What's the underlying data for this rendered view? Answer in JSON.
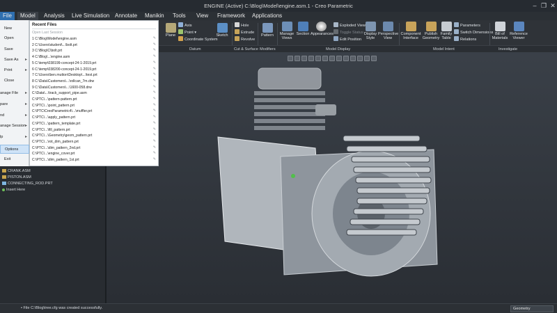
{
  "window": {
    "title": "ENGINE (Active) C:\\Blog\\Model\\engine.asm.1 - Creo Parametric"
  },
  "menu_tabs": [
    "File",
    "Model",
    "Analysis",
    "Live Simulation",
    "Annotate",
    "Manikin",
    "Tools",
    "View",
    "Framework",
    "Applications"
  ],
  "ribbon": {
    "datum": {
      "plane": "Plane",
      "axis": "Axis",
      "point": "Point",
      "csys": "Coordinate System",
      "sketch": "Sketch"
    },
    "cut_surface": {
      "hole": "Hole",
      "extrude": "Extrude",
      "revolve": "Revolve"
    },
    "pattern": "Pattern",
    "model_display": {
      "manage_views": "Manage Views",
      "section": "Section",
      "appearances": "Appearances",
      "exploded": "Exploded View",
      "toggle": "Toggle Status",
      "edit_pos": "Edit Position",
      "display_style": "Display Style",
      "perspective": "Perspective View"
    },
    "model_intent": {
      "component_interface": "Component Interface",
      "publish_geometry": "Publish Geometry",
      "family_table": "Family Table",
      "parameters": "Parameters",
      "switch_dim": "Switch Dimensions",
      "relations": "Relations"
    },
    "investigate": {
      "bom": "Bill of Materials",
      "ref_viewer": "Reference Viewer"
    }
  },
  "groups": [
    "Datum",
    "Cut & Surface",
    "Modifiers",
    "Model Display",
    "Model Intent",
    "Investigate"
  ],
  "file_menu": [
    {
      "label": "New",
      "arrow": false
    },
    {
      "label": "Open",
      "arrow": false
    },
    {
      "label": "Save",
      "arrow": false
    },
    {
      "label": "Save As",
      "arrow": true
    },
    {
      "label": "Print",
      "arrow": true
    },
    {
      "label": "Close",
      "arrow": false
    },
    {
      "label": "anage File",
      "arrow": true
    },
    {
      "label": "pare",
      "arrow": true
    },
    {
      "label": "nd",
      "arrow": true
    },
    {
      "label": "anage Session",
      "arrow": true
    },
    {
      "label": "lp",
      "arrow": true
    },
    {
      "label": "Options",
      "arrow": false
    },
    {
      "label": "Exit",
      "arrow": false
    }
  ],
  "recent": {
    "title": "Recent Files",
    "subtitle": "Open Last Session",
    "items": [
      "1 C:\\Blog\\Model\\engine.asm",
      "2 C:\\Users\\student\\...\\bolt.prt",
      "3 C:\\Blog\\C\\bolt.prt",
      "4 C:\\Blog\\...\\engine.asm",
      "5 C:\\temp\\038199-concept-24-1-2019.prt",
      "6 C:\\temp\\038200-concept-24-1-2019.prt",
      "7 C:\\Users\\ben.mutton\\Desktop\\...\\test.prt",
      "8 C:\\Data\\Customers\\...\\rollcan_7m.drw",
      "9 C:\\Data\\Customers\\...\\1600-058.drw",
      "C:\\Data\\...\\track_support_pipe.asm",
      "C:\\PTC\\...\\pattern-pattern.prt",
      "C:\\PTC\\...\\point_pattern.prt",
      "C:\\PTC\\CreoParametric4\\...\\muffler.prt",
      "C:\\PTC\\...\\apply_pattern.prt",
      "C:\\PTC\\...\\pattern_template.prt",
      "C:\\PTC\\...\\fill_pattern.prt",
      "C:\\PTC\\...\\Geometry\\geom_pattern.prt",
      "C:\\PTC\\...\\rot_dim_pattern.prt",
      "C:\\PTC\\...\\dim_pattern_2nd.prt",
      "C:\\PTC\\...\\engine_cover.prt",
      "C:\\PTC\\...\\dim_pattern_1st.prt"
    ]
  },
  "tree": [
    "CRANK.ASM",
    "PISTON.ASM",
    "CONNECTING_ROD.PRT",
    "Insert Here"
  ],
  "status": {
    "message": "File C:\\Blog\\tree.cfg was created successfully.",
    "filter": "Geometry"
  }
}
